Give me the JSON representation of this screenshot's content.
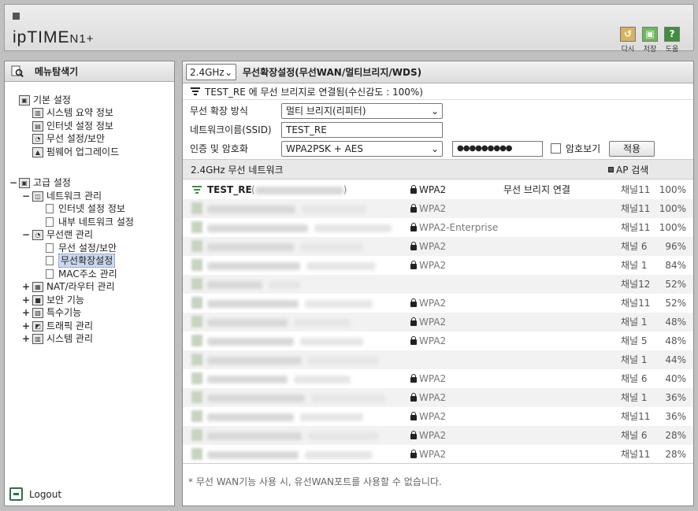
{
  "header": {
    "logo_brand": "ipTIME",
    "logo_model": "N1+",
    "buttons": [
      {
        "label": "다시",
        "icon": "back-icon",
        "color": "#d8b35e"
      },
      {
        "label": "저장",
        "icon": "save-icon",
        "color": "#6dba58"
      },
      {
        "label": "도움",
        "icon": "help-icon",
        "color": "#3f8f3f"
      }
    ]
  },
  "sidebar": {
    "title": "메뉴탐색기",
    "basic": {
      "label": "기본 설정",
      "items": [
        "시스템 요약 정보",
        "인터넷 설정 정보",
        "무선 설정/보안",
        "펌웨어 업그레이드"
      ]
    },
    "advanced": {
      "label": "고급 설정",
      "network": {
        "label": "네트워크 관리",
        "items": [
          "인터넷 설정 정보",
          "내부 네트워크 설정"
        ]
      },
      "wireless": {
        "label": "무선랜 관리",
        "items": [
          "무선 설정/보안",
          "무선확장설정",
          "MAC주소 관리"
        ]
      },
      "others": [
        "NAT/라우터 관리",
        "보안 기능",
        "특수기능",
        "트래픽 관리",
        "시스템 관리"
      ]
    },
    "expand_minus": "−",
    "expand_plus": "+",
    "logout": "Logout"
  },
  "main": {
    "band_select": "2.4GHz",
    "title": "무선확장설정(무선WAN/멀티브리지/WDS)",
    "status": "TEST_RE 에 무선 브리지로 연결됨(수신감도 : 100%)",
    "form": {
      "mode_label": "무선 확장 방식",
      "mode_value": "멀티 브리지(리피터)",
      "ssid_label": "네트워크이름(SSID)",
      "ssid_value": "TEST_RE",
      "auth_label": "인증 및 암호화",
      "auth_value": "WPA2PSK + AES",
      "password_value": "●●●●●●●●●",
      "show_pw_label": "암호보기",
      "apply_label": "적용"
    },
    "list_title": "2.4GHz 무선 네트워크",
    "ap_search": "AP 검색",
    "aps": [
      {
        "name": "TEST_RE",
        "sec": "WPA2",
        "status": "무선 브리지 연결",
        "ch": "채널11",
        "signal": "100%"
      },
      {
        "name": "",
        "sec": "WPA2",
        "status": "",
        "ch": "채널11",
        "signal": "100%"
      },
      {
        "name": "",
        "sec": "WPA2-Enterprise",
        "status": "",
        "ch": "채널11",
        "signal": "100%"
      },
      {
        "name": "",
        "sec": "WPA2",
        "status": "",
        "ch": "채널 6",
        "signal": "96%"
      },
      {
        "name": "",
        "sec": "WPA2",
        "status": "",
        "ch": "채널 1",
        "signal": "84%"
      },
      {
        "name": "",
        "sec": "",
        "status": "",
        "ch": "채널12",
        "signal": "52%"
      },
      {
        "name": "",
        "sec": "WPA2",
        "status": "",
        "ch": "채널11",
        "signal": "52%"
      },
      {
        "name": "",
        "sec": "WPA2",
        "status": "",
        "ch": "채널 1",
        "signal": "48%"
      },
      {
        "name": "",
        "sec": "WPA2",
        "status": "",
        "ch": "채널 5",
        "signal": "48%"
      },
      {
        "name": "",
        "sec": "",
        "status": "",
        "ch": "채널 1",
        "signal": "44%"
      },
      {
        "name": "",
        "sec": "WPA2",
        "status": "",
        "ch": "채널 6",
        "signal": "40%"
      },
      {
        "name": "",
        "sec": "WPA2",
        "status": "",
        "ch": "채널 1",
        "signal": "36%"
      },
      {
        "name": "",
        "sec": "WPA2",
        "status": "",
        "ch": "채널11",
        "signal": "36%"
      },
      {
        "name": "",
        "sec": "WPA2",
        "status": "",
        "ch": "채널 6",
        "signal": "28%"
      },
      {
        "name": "",
        "sec": "WPA2",
        "status": "",
        "ch": "채널11",
        "signal": "28%"
      }
    ],
    "note": "* 무선 WAN기능 사용 시, 유선WAN포트를 사용할 수 없습니다."
  }
}
